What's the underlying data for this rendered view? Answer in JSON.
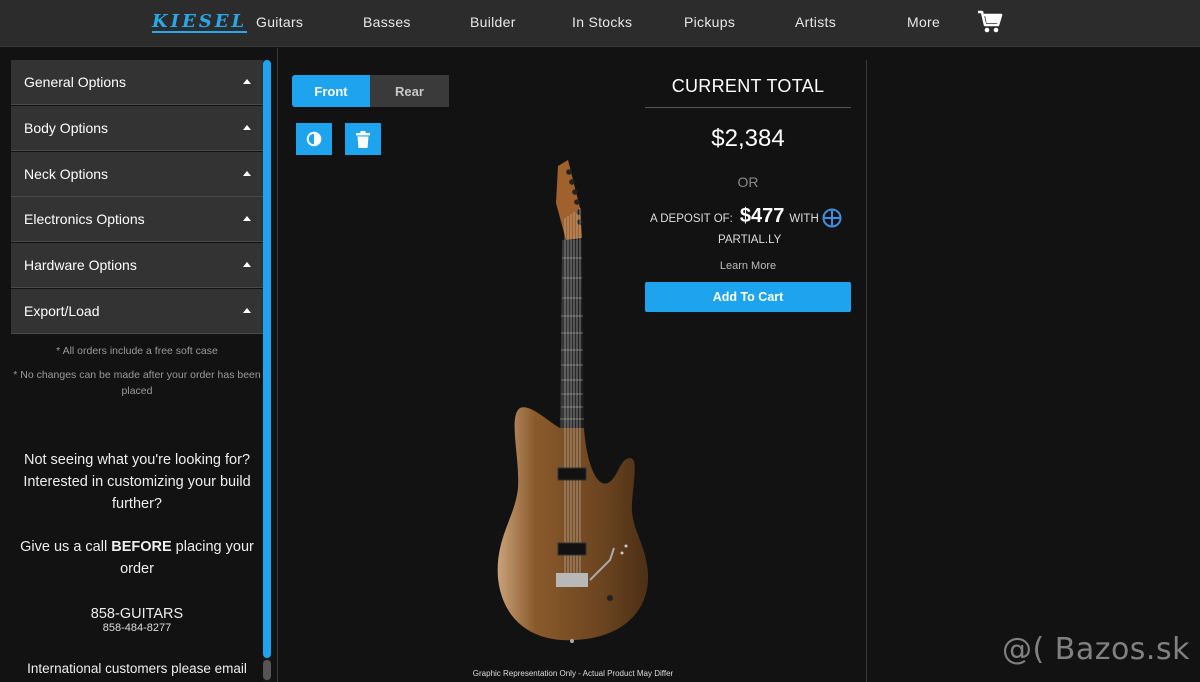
{
  "nav": {
    "logo": "KIESEL",
    "items": [
      {
        "label": "Guitars"
      },
      {
        "label": "Basses"
      },
      {
        "label": "Builder"
      },
      {
        "label": "In Stocks"
      },
      {
        "label": "Pickups"
      },
      {
        "label": "Artists"
      },
      {
        "label": "More"
      }
    ],
    "cart_icon": "shopping-cart-icon"
  },
  "sidebar": {
    "sections": [
      {
        "label": "General Options"
      },
      {
        "label": "Body Options"
      },
      {
        "label": "Neck Options"
      },
      {
        "label": "Electronics Options"
      },
      {
        "label": "Hardware Options"
      },
      {
        "label": "Export/Load"
      }
    ],
    "note_case": "* All orders include a free soft case",
    "note_changes": "* No changes can be made after your order has been placed",
    "help_1": "Not seeing what you're looking for? Interested in customizing your build further?",
    "help_2_prefix": "Give us a call ",
    "help_2_bold": "BEFORE",
    "help_2_suffix": " placing your order",
    "phone_name": "858-GUITARS",
    "phone_number": "858-484-8277",
    "intl": "International customers please email"
  },
  "viewer": {
    "tabs": [
      {
        "label": "Front",
        "active": true
      },
      {
        "label": "Rear",
        "active": false
      }
    ],
    "tools": [
      {
        "icon": "contrast-icon"
      },
      {
        "icon": "trash-icon"
      }
    ],
    "disclaimer": "Graphic Representation Only - Actual Product May Differ"
  },
  "total": {
    "title": "CURRENT TOTAL",
    "price": "$2,384",
    "or": "OR",
    "deposit_prefix": "A DEPOSIT OF:",
    "deposit_amount": "$477",
    "deposit_with": "WITH",
    "provider": "PARTIAL.LY",
    "learn_more": "Learn More",
    "add_to_cart": "Add To Cart"
  },
  "watermark": "@( Bazos.sk",
  "colors": {
    "accent": "#1ea4ef",
    "nav_bg": "#2c2c2c",
    "page_bg": "#121212",
    "panel": "#333333"
  }
}
